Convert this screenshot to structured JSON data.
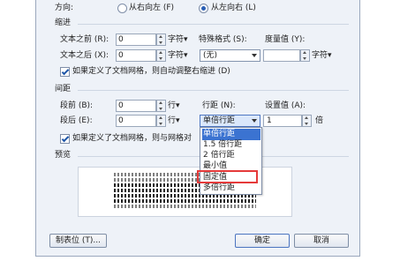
{
  "direction": {
    "label": "方向:",
    "rtl": "从右向左 (F)",
    "ltr": "从左向右 (L)"
  },
  "indent": {
    "group": "缩进",
    "before_label": "文本之前 (R):",
    "before_value": "0",
    "unit1": "字符",
    "special_label": "特殊格式 (S):",
    "special_value": "(无)",
    "measure_label": "度量值 (Y):",
    "after_label": "文本之后 (X):",
    "after_value": "0",
    "unit2": "字符",
    "unit3": "字符",
    "grid_check": "如果定义了文档网格，则自动调整右缩进 (D)"
  },
  "spacing": {
    "group": "间距",
    "before_label": "段前 (B):",
    "before_value": "0",
    "unit_before": "行",
    "line_label": "行距 (N):",
    "setval_label": "设置值 (A):",
    "after_label": "段后 (E):",
    "after_value": "0",
    "unit_after": "行",
    "line_value": "单倍行距",
    "setval_value": "1",
    "setval_unit": "倍",
    "grid_check": "如果定义了文档网格，则与网格对"
  },
  "dropdown": {
    "options": [
      "单倍行距",
      "1.5 倍行距",
      "2 倍行距",
      "最小值",
      "固定值",
      "多倍行距"
    ],
    "selected": "单倍行距",
    "highlighted": "固定值"
  },
  "preview": {
    "label": "预览"
  },
  "buttons": {
    "tabs": "制表位 (T)...",
    "ok": "确定",
    "cancel": "取消"
  },
  "colors": {
    "selection": "#3b73d1",
    "highlight": "#e53a3a"
  }
}
